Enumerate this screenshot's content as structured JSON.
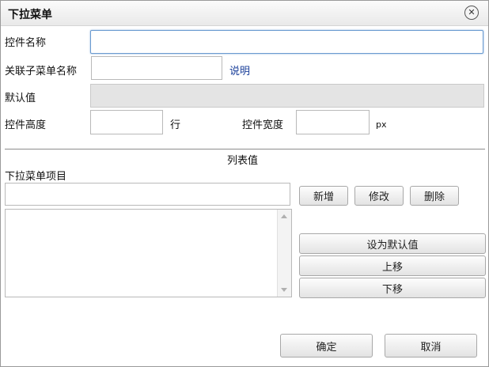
{
  "dialog": {
    "title": "下拉菜单",
    "close_glyph": "✕"
  },
  "form": {
    "control_name_label": "控件名称",
    "control_name_value": "",
    "assoc_menu_label": "关联子菜单名称",
    "assoc_menu_value": "",
    "help_link": "说明",
    "default_label": "默认值",
    "default_value": "",
    "height_label": "控件高度",
    "height_value": "",
    "height_unit": "行",
    "width_label": "控件宽度",
    "width_value": "",
    "width_unit": "px"
  },
  "list_section": {
    "heading": "列表值",
    "items_label": "下拉菜单项目",
    "item_input_value": "",
    "add_button": "新增",
    "edit_button": "修改",
    "delete_button": "删除",
    "items": [],
    "set_default_button": "设为默认值",
    "move_up_button": "上移",
    "move_down_button": "下移"
  },
  "footer": {
    "ok_button": "确定",
    "cancel_button": "取消"
  }
}
